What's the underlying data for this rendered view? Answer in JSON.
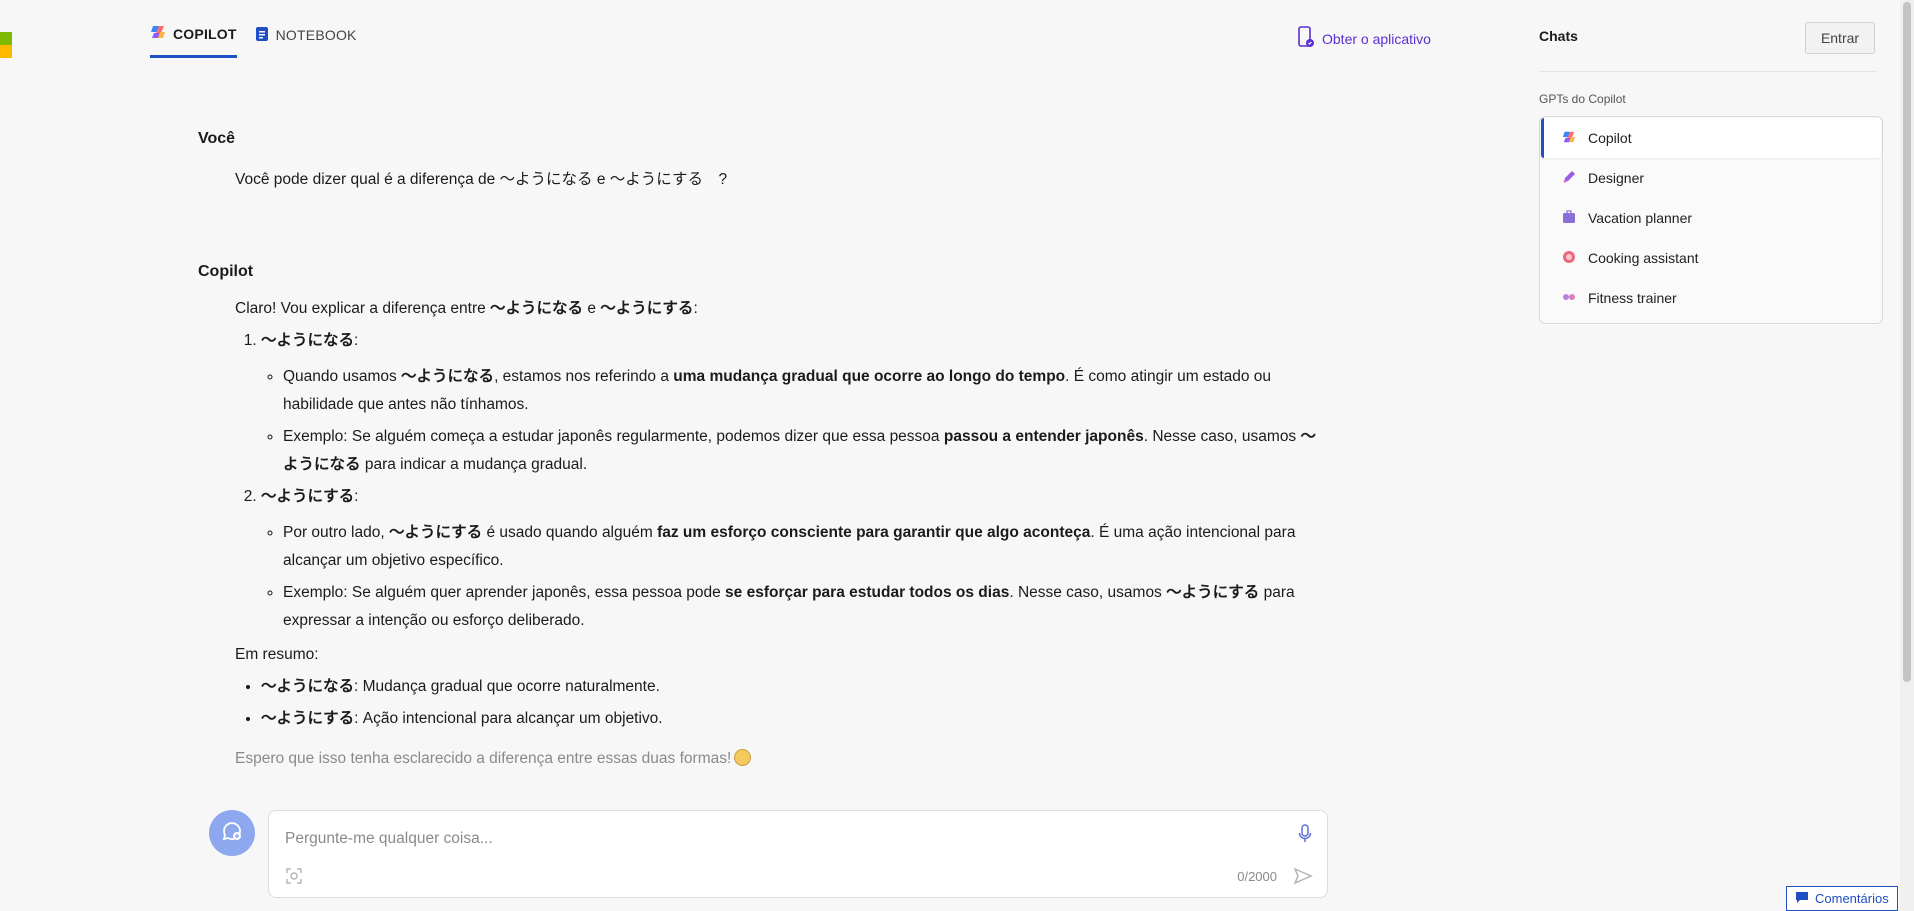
{
  "nav": {
    "tabs": [
      {
        "label": "COPILOT",
        "active": true
      },
      {
        "label": "NOTEBOOK",
        "active": false
      }
    ],
    "get_app": "Obter o aplicativo"
  },
  "conversation": {
    "user": {
      "name": "Você",
      "text": "Você pode dizer qual é a diferença de ～ようになる e ～ようにする　?"
    },
    "assistant": {
      "name": "Copilot",
      "intro": [
        "Claro! Vou explicar a diferença entre ",
        "～ようになる",
        " e ",
        "～ようにする",
        ":"
      ],
      "items": [
        {
          "title": "～ようになる",
          "title_suffix": ":",
          "bullets": [
            {
              "a": "Quando usamos ",
              "b": "～ようになる",
              "c": ", estamos nos referindo a ",
              "d": "uma mudança gradual que ocorre ao longo do tempo",
              "e": ". É como atingir um estado ou habilidade que antes não tínhamos."
            },
            {
              "a": "Exemplo: Se alguém começa a estudar japonês regularmente, podemos dizer que essa pessoa ",
              "b": "passou a entender japonês",
              "c": ". Nesse caso, usamos ",
              "d": "～ようになる",
              "e": " para indicar a mudança gradual."
            }
          ]
        },
        {
          "title": "～ようにする",
          "title_suffix": ":",
          "bullets": [
            {
              "a": "Por outro lado, ",
              "b": "～ようにする",
              "c": " é usado quando alguém ",
              "d": "faz um esforço consciente para garantir que algo aconteça",
              "e": ". É uma ação intencional para alcançar um objetivo específico."
            },
            {
              "a": "Exemplo: Se alguém quer aprender japonês, essa pessoa pode ",
              "b": "se esforçar para estudar todos os dias",
              "c": ". Nesse caso, usamos ",
              "d": "～ようにする",
              "e": " para expressar a intenção ou esforço deliberado."
            }
          ]
        }
      ],
      "summary_label": "Em resumo:",
      "summary": [
        {
          "term": "～ようになる",
          "text": ": Mudança gradual que ocorre naturalmente."
        },
        {
          "term": "～ようにする",
          "text": ": Ação intencional para alcançar um objetivo."
        }
      ],
      "closing": "Espero que isso tenha esclarecido a diferença entre essas duas formas!"
    }
  },
  "composer": {
    "placeholder": "Pergunte-me qualquer coisa...",
    "counter": "0/2000"
  },
  "sidebar": {
    "title": "Chats",
    "login": "Entrar",
    "gpts_label": "GPTs do Copilot",
    "gpts": [
      {
        "label": "Copilot",
        "icon": "copilot-icon",
        "selected": true
      },
      {
        "label": "Designer",
        "icon": "designer-icon",
        "selected": false
      },
      {
        "label": "Vacation planner",
        "icon": "suitcase-icon",
        "selected": false
      },
      {
        "label": "Cooking assistant",
        "icon": "cooking-icon",
        "selected": false
      },
      {
        "label": "Fitness trainer",
        "icon": "dumbbell-icon",
        "selected": false
      }
    ]
  },
  "feedback": "Comentários",
  "colors": {
    "accent": "#1f4ec5",
    "link": "#5b2fd0",
    "background": "#f7f7f7"
  }
}
